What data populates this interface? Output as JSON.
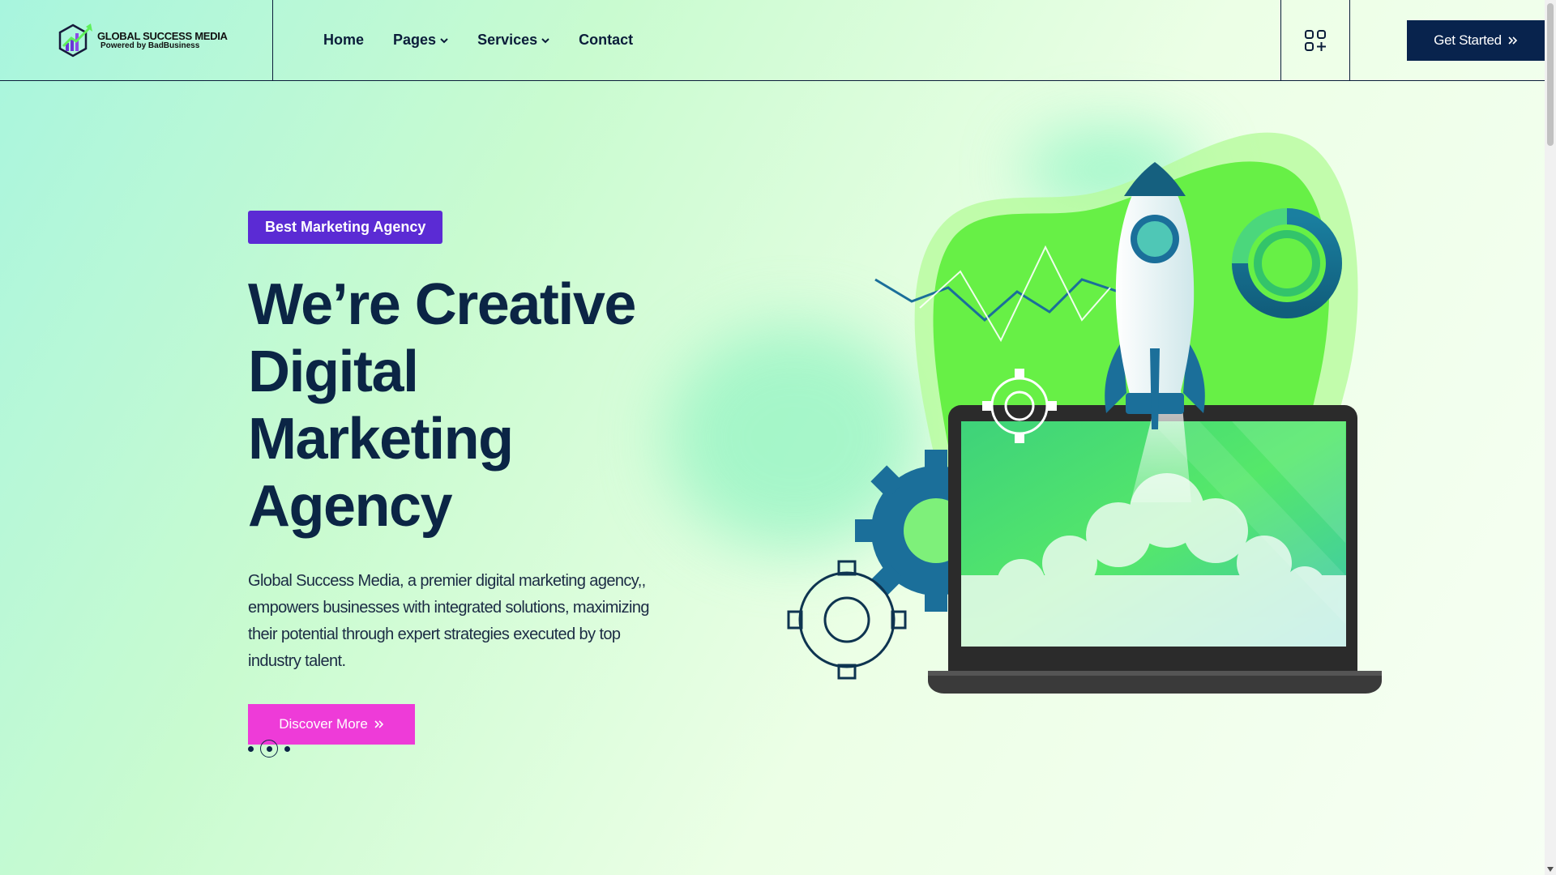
{
  "brand": {
    "title": "GLOBAL SUCCESS MEDIA",
    "subtitle": "Powered by BadBusiness"
  },
  "nav": {
    "items": [
      {
        "label": "Home",
        "has_dropdown": false
      },
      {
        "label": "Pages",
        "has_dropdown": true
      },
      {
        "label": "Services",
        "has_dropdown": true
      },
      {
        "label": "Contact",
        "has_dropdown": false
      }
    ],
    "grid_icon": "apps-plus-icon",
    "cta_label": "Get Started"
  },
  "hero": {
    "badge": "Best Marketing Agency",
    "headline_lines": [
      "We’re Creative",
      "Digital",
      "Marketing",
      "Agency"
    ],
    "description": "Global Success Media, a premier digital marketing agency,, empowers businesses with integrated solutions, maximizing their potential through expert strategies executed by top industry talent.",
    "button_label": "Discover More",
    "slider": {
      "count": 3,
      "active_index": 1
    }
  },
  "colors": {
    "navy": "#0b2545",
    "badge_purple": "#5b2bd4",
    "button_pink": "#ee3bd8",
    "cta_navy": "#08234d",
    "accent_green": "#5ef05a"
  }
}
